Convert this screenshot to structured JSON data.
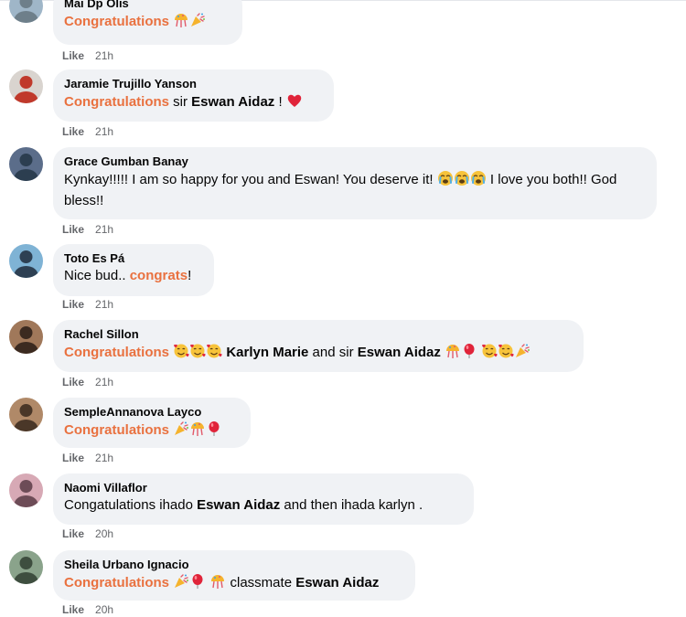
{
  "comments": [
    {
      "author": "Mai Dp Olis",
      "segments": [
        {
          "k": "hl",
          "t": "Congratulations"
        },
        {
          "k": "t",
          "t": " "
        },
        {
          "k": "emoji",
          "name": "confetti-ball-icon"
        },
        {
          "k": "emoji",
          "name": "party-popper-icon"
        }
      ],
      "like": "Like",
      "time": "21h",
      "avatar_colors": [
        "#9fb6c8",
        "#6e7f8a"
      ]
    },
    {
      "author": "Jaramie Trujillo Yanson",
      "segments": [
        {
          "k": "hl",
          "t": "Congratulations"
        },
        {
          "k": "t",
          "t": " sir "
        },
        {
          "k": "m",
          "t": "Eswan Aidaz"
        },
        {
          "k": "t",
          "t": " ! "
        },
        {
          "k": "emoji",
          "name": "red-heart-icon"
        }
      ],
      "like": "Like",
      "time": "21h",
      "avatar_colors": [
        "#d9d4cf",
        "#c0392b"
      ]
    },
    {
      "author": "Grace Gumban Banay",
      "segments": [
        {
          "k": "t",
          "t": "Kynkay!!!!! I am so happy for you and Eswan! You deserve it! "
        },
        {
          "k": "emoji",
          "name": "crying-face-icon"
        },
        {
          "k": "emoji",
          "name": "crying-face-icon"
        },
        {
          "k": "emoji",
          "name": "crying-face-icon"
        },
        {
          "k": "t",
          "t": " I love you both!! God bless!!"
        }
      ],
      "like": "Like",
      "time": "21h",
      "avatar_colors": [
        "#5b6d8a",
        "#2c3e50"
      ]
    },
    {
      "author": "Toto Es Pá",
      "segments": [
        {
          "k": "t",
          "t": "Nice bud.. "
        },
        {
          "k": "hl",
          "t": "congrats"
        },
        {
          "k": "t",
          "t": "!"
        }
      ],
      "like": "Like",
      "time": "21h",
      "avatar_colors": [
        "#7fb3d5",
        "#2e4053"
      ]
    },
    {
      "author": "Rachel Sillon",
      "segments": [
        {
          "k": "hl",
          "t": "Congratulations"
        },
        {
          "k": "t",
          "t": " "
        },
        {
          "k": "emoji",
          "name": "smiling-face-with-hearts-icon"
        },
        {
          "k": "emoji",
          "name": "smiling-face-with-hearts-icon"
        },
        {
          "k": "emoji",
          "name": "smiling-face-with-hearts-icon"
        },
        {
          "k": "t",
          "t": " "
        },
        {
          "k": "m",
          "t": "Karlyn Marie"
        },
        {
          "k": "t",
          "t": " and sir "
        },
        {
          "k": "m",
          "t": "Eswan Aidaz"
        },
        {
          "k": "t",
          "t": " "
        },
        {
          "k": "emoji",
          "name": "confetti-ball-icon"
        },
        {
          "k": "emoji",
          "name": "balloon-icon"
        },
        {
          "k": "t",
          "t": " "
        },
        {
          "k": "emoji",
          "name": "smiling-face-with-hearts-icon"
        },
        {
          "k": "emoji",
          "name": "smiling-face-with-hearts-icon"
        },
        {
          "k": "emoji",
          "name": "party-popper-icon"
        }
      ],
      "like": "Like",
      "time": "21h",
      "avatar_colors": [
        "#a0785a",
        "#3b2a20"
      ]
    },
    {
      "author": "SempleAnnanova Layco",
      "segments": [
        {
          "k": "hl",
          "t": "Congratulations"
        },
        {
          "k": "t",
          "t": " "
        },
        {
          "k": "emoji",
          "name": "party-popper-icon"
        },
        {
          "k": "emoji",
          "name": "confetti-ball-icon"
        },
        {
          "k": "emoji",
          "name": "balloon-icon"
        }
      ],
      "like": "Like",
      "time": "21h",
      "avatar_colors": [
        "#b08968",
        "#4a3728"
      ]
    },
    {
      "author": "Naomi Villaflor",
      "segments": [
        {
          "k": "t",
          "t": "Congatulations ihado "
        },
        {
          "k": "m",
          "t": "Eswan Aidaz"
        },
        {
          "k": "t",
          "t": " and then ihada karlyn ."
        }
      ],
      "like": "Like",
      "time": "20h",
      "avatar_colors": [
        "#d7a9b5",
        "#6d4c57"
      ]
    },
    {
      "author": "Sheila Urbano Ignacio",
      "segments": [
        {
          "k": "hl",
          "t": "Congratulations"
        },
        {
          "k": "t",
          "t": " "
        },
        {
          "k": "emoji",
          "name": "party-popper-icon"
        },
        {
          "k": "emoji",
          "name": "balloon-icon"
        },
        {
          "k": "t",
          "t": " "
        },
        {
          "k": "emoji",
          "name": "confetti-ball-icon"
        },
        {
          "k": "t",
          "t": " classmate "
        },
        {
          "k": "m",
          "t": "Eswan Aidaz"
        }
      ],
      "like": "Like",
      "time": "20h",
      "avatar_colors": [
        "#8aa38b",
        "#3e4e3f"
      ]
    }
  ]
}
